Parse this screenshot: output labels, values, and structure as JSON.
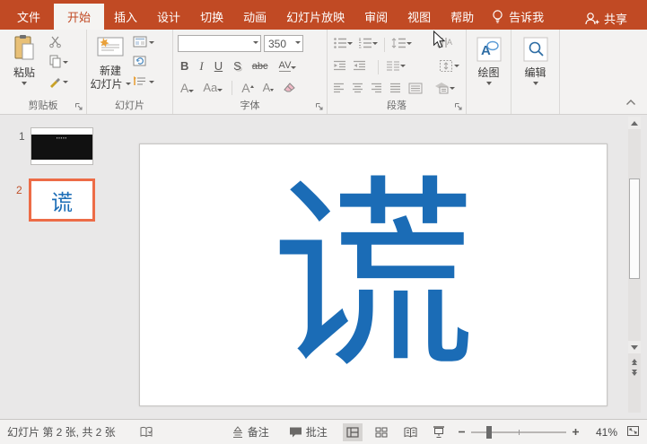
{
  "colors": {
    "accent_red": "#C14A24",
    "accent_blue": "#1B6CB6",
    "selection_orange": "#ED6C47"
  },
  "titlebar": {
    "tabs": [
      {
        "label": "文件"
      },
      {
        "label": "开始",
        "selected": true
      },
      {
        "label": "插入"
      },
      {
        "label": "设计"
      },
      {
        "label": "切换"
      },
      {
        "label": "动画"
      },
      {
        "label": "幻灯片放映"
      },
      {
        "label": "审阅"
      },
      {
        "label": "视图"
      },
      {
        "label": "帮助"
      }
    ],
    "tell_me": "告诉我",
    "share": "共享"
  },
  "ribbon": {
    "clipboard": {
      "paste": "粘贴",
      "label": "剪贴板"
    },
    "slides": {
      "new_slide_line1": "新建",
      "new_slide_line2": "幻灯片",
      "label": "幻灯片"
    },
    "font": {
      "font_name_value": "",
      "size_value": "350",
      "bold": "B",
      "italic": "I",
      "underline": "U",
      "shadow": "S",
      "strikethrough": "abc",
      "char_spacing": "AV",
      "font_color": "A",
      "change_case": "Aa",
      "grow_font": "A",
      "shrink_font": "A",
      "label": "字体"
    },
    "paragraph": {
      "label": "段落"
    },
    "drawing": {
      "button": "绘图"
    },
    "editing": {
      "button": "编辑"
    }
  },
  "slide_panel": {
    "slides": [
      {
        "number": "1",
        "thumb_text": "▪▪▪▪▪"
      },
      {
        "number": "2",
        "thumb_text": "谎",
        "selected": true
      }
    ]
  },
  "canvas": {
    "slide_text": "谎"
  },
  "statusbar": {
    "slide_info": "幻灯片 第 2 张, 共 2 张",
    "notes_label": "备注",
    "comments_label": "批注",
    "zoom_value": "41%"
  }
}
